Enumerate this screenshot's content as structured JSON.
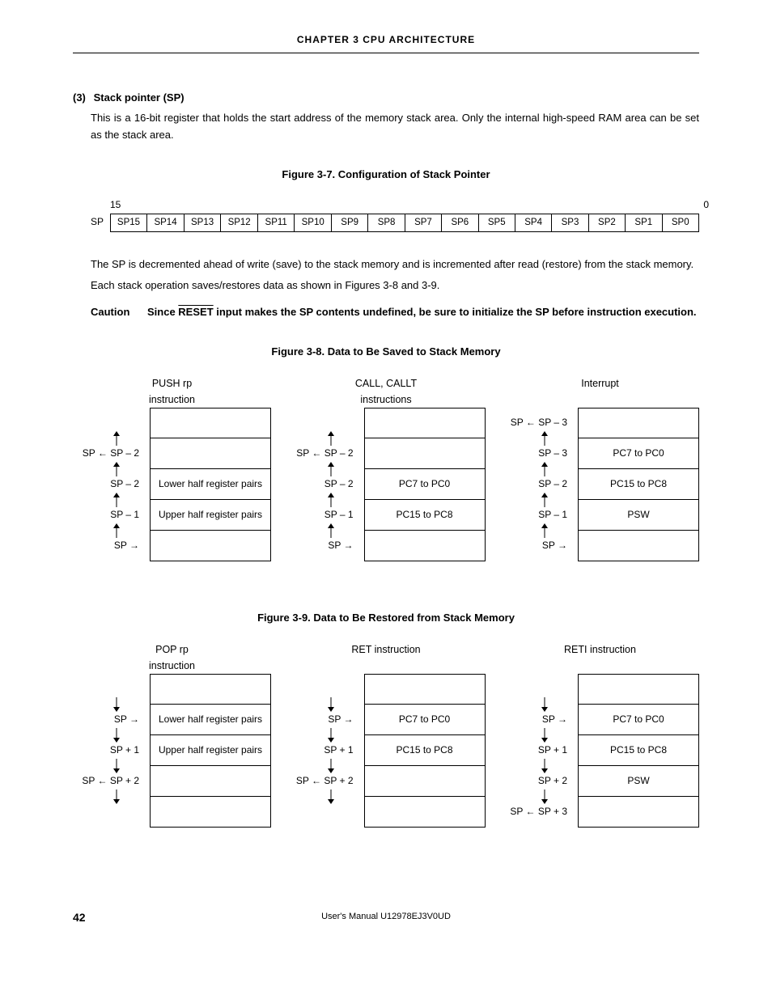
{
  "header": {
    "chapter": "CHAPTER  3    CPU  ARCHITECTURE"
  },
  "section": {
    "num": "(3)",
    "title": "Stack pointer (SP)",
    "para1": "This is a 16-bit register that holds the start address of the memory stack area.  Only the internal high-speed RAM area can be set as the stack area.",
    "para2": "The SP is decremented ahead of write (save) to the stack memory and is incremented after read (restore) from the stack memory.",
    "para3": "Each stack operation saves/restores data as shown in Figures 3-8 and 3-9."
  },
  "fig37": {
    "title": "Figure 3-7.  Configuration of Stack Pointer",
    "msb": "15",
    "lsb": "0",
    "label": "SP",
    "bits": [
      "SP15",
      "SP14",
      "SP13",
      "SP12",
      "SP11",
      "SP10",
      "SP9",
      "SP8",
      "SP7",
      "SP6",
      "SP5",
      "SP4",
      "SP3",
      "SP2",
      "SP1",
      "SP0"
    ]
  },
  "caution": {
    "label": "Caution",
    "pre": "Since ",
    "reset": "RESET",
    "post": " input makes the SP contents undefined, be sure to initialize the SP before instruction execution."
  },
  "fig38": {
    "title": "Figure 3-8.  Data to Be Saved to Stack Memory",
    "cols": [
      {
        "head": "PUSH rp\ninstruction",
        "rows": [
          {
            "lab": "",
            "cell": ""
          },
          {
            "lab": "SP ← SP – 2",
            "cell": ""
          },
          {
            "lab": "SP – 2",
            "cell": "Lower half register pairs"
          },
          {
            "lab": "SP – 1",
            "cell": "Upper half register pairs"
          },
          {
            "lab": "SP →",
            "cell": ""
          }
        ]
      },
      {
        "head": "CALL, CALLT\ninstructions",
        "rows": [
          {
            "lab": "",
            "cell": ""
          },
          {
            "lab": "SP ← SP – 2",
            "cell": ""
          },
          {
            "lab": "SP – 2",
            "cell": "PC7 to PC0"
          },
          {
            "lab": "SP – 1",
            "cell": "PC15 to PC8"
          },
          {
            "lab": "SP →",
            "cell": ""
          }
        ]
      },
      {
        "head": "Interrupt",
        "rows": [
          {
            "lab": "SP ← SP – 3",
            "cell": ""
          },
          {
            "lab": "SP – 3",
            "cell": "PC7 to PC0"
          },
          {
            "lab": "SP – 2",
            "cell": "PC15 to PC8"
          },
          {
            "lab": "SP – 1",
            "cell": "PSW"
          },
          {
            "lab": "SP →",
            "cell": ""
          }
        ]
      }
    ]
  },
  "fig39": {
    "title": "Figure 3-9.  Data to Be Restored from Stack Memory",
    "cols": [
      {
        "head": "POP rp\ninstruction",
        "rows": [
          {
            "lab": "",
            "cell": ""
          },
          {
            "lab": "SP →",
            "cell": "Lower half register pairs"
          },
          {
            "lab": "SP + 1",
            "cell": "Upper half register pairs"
          },
          {
            "lab": "SP ← SP + 2",
            "cell": ""
          },
          {
            "lab": "",
            "cell": ""
          }
        ]
      },
      {
        "head": "RET instruction",
        "rows": [
          {
            "lab": "",
            "cell": ""
          },
          {
            "lab": "SP →",
            "cell": "PC7 to PC0"
          },
          {
            "lab": "SP + 1",
            "cell": "PC15 to PC8"
          },
          {
            "lab": "SP ← SP + 2",
            "cell": ""
          },
          {
            "lab": "",
            "cell": ""
          }
        ]
      },
      {
        "head": "RETI instruction",
        "rows": [
          {
            "lab": "",
            "cell": ""
          },
          {
            "lab": "SP →",
            "cell": "PC7 to PC0"
          },
          {
            "lab": "SP + 1",
            "cell": "PC15 to PC8"
          },
          {
            "lab": "SP + 2",
            "cell": "PSW"
          },
          {
            "lab": "SP ← SP + 3",
            "cell": ""
          }
        ]
      }
    ]
  },
  "footer": {
    "page": "42",
    "doc": "User's Manual  U12978EJ3V0UD"
  }
}
